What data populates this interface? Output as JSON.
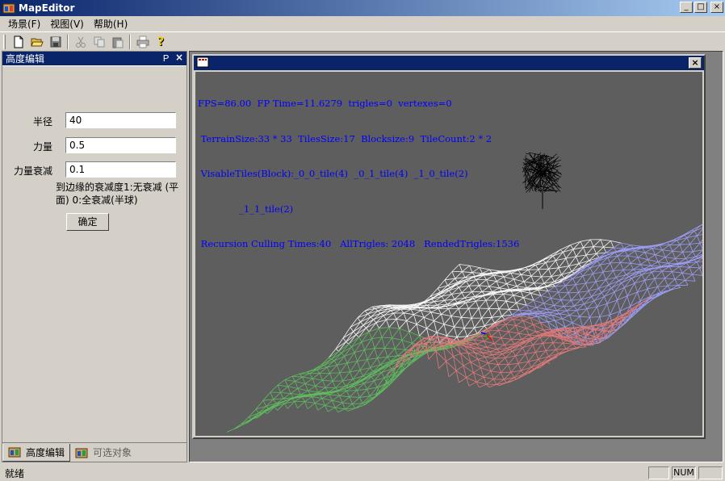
{
  "window": {
    "title": "MapEditor",
    "min": "_",
    "max": "□",
    "close": "×"
  },
  "menu": [
    {
      "label": "场景(F)"
    },
    {
      "label": "视图(V)"
    },
    {
      "label": "帮助(H)"
    }
  ],
  "toolbar": {
    "buttons": [
      "new-file-icon",
      "open-folder-icon",
      "save-icon",
      "cut-icon",
      "copy-icon",
      "paste-icon",
      "print-icon",
      "help-icon"
    ]
  },
  "panel": {
    "title": "高度编辑",
    "pin": "Ｐ",
    "close": "×",
    "fields": [
      {
        "label": "半径",
        "value": "40"
      },
      {
        "label": "力量",
        "value": "0.5"
      },
      {
        "label": "力量衰减",
        "value": "0.1"
      }
    ],
    "hint": "到边缘的衰减度1:无衰减 (平面) 0:全衰减(半球)",
    "ok": "确定",
    "tabs": [
      {
        "label": "高度编辑"
      },
      {
        "label": "可选对象"
      }
    ]
  },
  "view": {
    "close": "×",
    "stats": [
      "FPS=86.00  FP Time=11.6279  trigles=0  vertexes=0",
      " TerrainSize:33 * 33  TilesSize:17  Blocksize:9  TileCount:2 * 2",
      " VisableTiles(Block):_0_0_tile(4)  _0_1_tile(4)  _1_0_tile(2)",
      "              _1_1_tile(2)",
      " Recursion Culling Times:40   AllTrigles: 2048   RendedTrigles:1536"
    ]
  },
  "status": {
    "text": "就绪",
    "panes": [
      "",
      "NUM",
      ""
    ]
  },
  "colors": {
    "title_blue": "#0a246a",
    "stats_blue": "#0000ff",
    "viewport_bg": "#5e5e5e"
  }
}
